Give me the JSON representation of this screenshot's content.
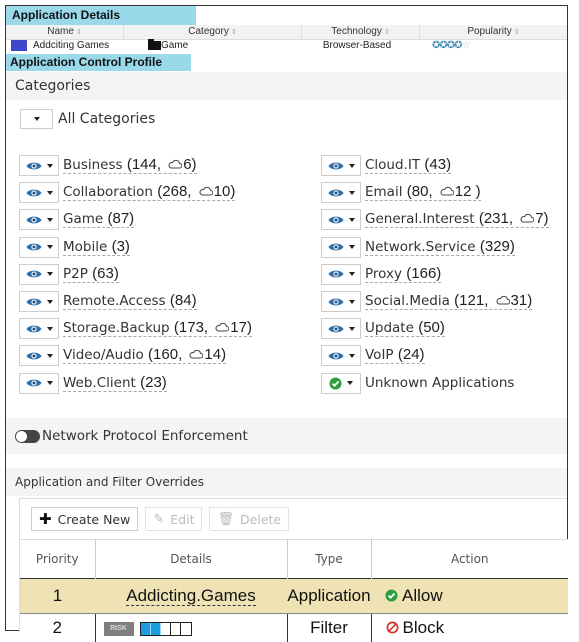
{
  "app_details": {
    "title": "Application Details",
    "columns": [
      "Name",
      "Category",
      "Technology",
      "Popularity"
    ],
    "row": {
      "name": "Addciting Games",
      "category": "Game",
      "technology": "Browser-Based",
      "popularity_stars": 4,
      "popularity_max": 5
    },
    "name_swatch_color": "#3f48cc"
  },
  "profile": {
    "title": "Application Control Profile"
  },
  "categories": {
    "heading": "Categories",
    "all_label": "All Categories",
    "left": [
      {
        "name": "Business",
        "count": "(144, ",
        "cloud": "6)",
        "icon": "eye-icon"
      },
      {
        "name": "Collaboration",
        "count": "(268, ",
        "cloud": "10)",
        "icon": "eye-icon"
      },
      {
        "name": "Game",
        "count": "(87)",
        "cloud": null,
        "icon": "eye-icon"
      },
      {
        "name": "Mobile",
        "count": "(3)",
        "cloud": null,
        "icon": "eye-icon"
      },
      {
        "name": "P2P",
        "count": "(63)",
        "cloud": null,
        "icon": "eye-icon"
      },
      {
        "name": "Remote.Access",
        "count": "(84)",
        "cloud": null,
        "icon": "eye-icon"
      },
      {
        "name": "Storage.Backup",
        "count": "(173, ",
        "cloud": "17)",
        "icon": "eye-icon"
      },
      {
        "name": "Video/Audio",
        "count": "(160, ",
        "cloud": "14)",
        "icon": "eye-icon"
      },
      {
        "name": "Web.Client",
        "count": "(23)",
        "cloud": null,
        "icon": "eye-icon"
      }
    ],
    "right": [
      {
        "name": "Cloud.IT",
        "count": "(43)",
        "cloud": null,
        "icon": "eye-icon"
      },
      {
        "name": "Email",
        "count": "(80, ",
        "cloud": "12 )",
        "icon": "eye-icon"
      },
      {
        "name": "General.Interest",
        "count": "(231, ",
        "cloud": "7)",
        "icon": "eye-icon"
      },
      {
        "name": "Network.Service",
        "count": "(329)",
        "cloud": null,
        "icon": "eye-icon"
      },
      {
        "name": "Proxy",
        "count": "(166)",
        "cloud": null,
        "icon": "eye-icon"
      },
      {
        "name": "Social.Media",
        "count": "(121, ",
        "cloud": "31)",
        "icon": "eye-icon"
      },
      {
        "name": "Update",
        "count": "(50)",
        "cloud": null,
        "icon": "eye-icon"
      },
      {
        "name": "VoIP",
        "count": "(24)",
        "cloud": null,
        "icon": "eye-icon"
      },
      {
        "name": "Unknown Applications",
        "count": null,
        "cloud": null,
        "icon": "check-icon"
      }
    ]
  },
  "network_protocol": {
    "label": "Network Protocol Enforcement",
    "enabled": false
  },
  "overrides": {
    "heading": "Application and Filter Overrides",
    "toolbar": {
      "create_new": "Create New",
      "edit": "Edit",
      "delete": "Delete"
    },
    "columns": [
      "Priority",
      "Details",
      "Type",
      "Action"
    ],
    "rows": [
      {
        "priority": "1",
        "details": "Addicting.Games",
        "type": "Application",
        "action": "Allow"
      },
      {
        "priority": "2",
        "details_badge": "RISK",
        "risk_level": 2,
        "risk_max": 5,
        "type": "Filter",
        "action": "Block"
      }
    ]
  },
  "colors": {
    "section_header_bg": "#99d9ea",
    "highlight_row": "#efe3b5",
    "allow_green": "#2e9e3e",
    "block_red": "#d9332f",
    "eye_blue": "#2f6fa8",
    "risk_blue": "#1a9de0"
  }
}
